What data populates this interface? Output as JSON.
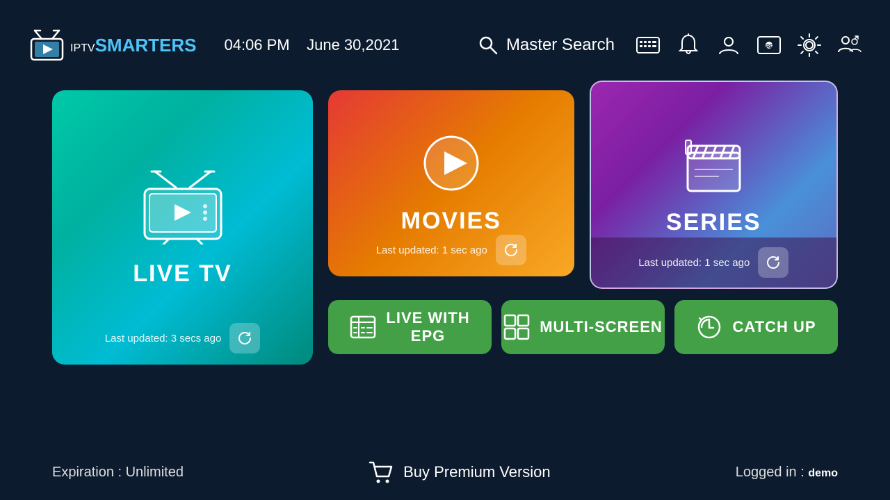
{
  "header": {
    "logo_iptv": "IPTV",
    "logo_smarters": "SMARTERS",
    "time": "04:06 PM",
    "date": "June 30,2021",
    "search_label": "Master Search"
  },
  "icons": {
    "epg_icon": "📺",
    "bell_icon": "🔔",
    "profile_icon": "👤",
    "record_icon": "⏺",
    "settings_icon": "⚙",
    "switch_user_icon": "👥"
  },
  "cards": {
    "live_tv": {
      "title": "LIVE TV",
      "footer": "Last updated: 3 secs ago"
    },
    "movies": {
      "title": "MOVIES",
      "footer": "Last updated: 1 sec ago"
    },
    "series": {
      "title": "SERIES",
      "footer": "Last updated: 1 sec ago"
    }
  },
  "buttons": {
    "live_epg": "LIVE WITH\nEPG",
    "live_epg_line1": "LIVE WITH",
    "live_epg_line2": "EPG",
    "multi_screen": "MULTI-SCREEN",
    "catch_up": "CATCH UP"
  },
  "bottom": {
    "expiration": "Expiration : Unlimited",
    "buy_premium": "Buy Premium Version",
    "logged_in_label": "Logged in : ",
    "logged_in_user": "demo"
  }
}
